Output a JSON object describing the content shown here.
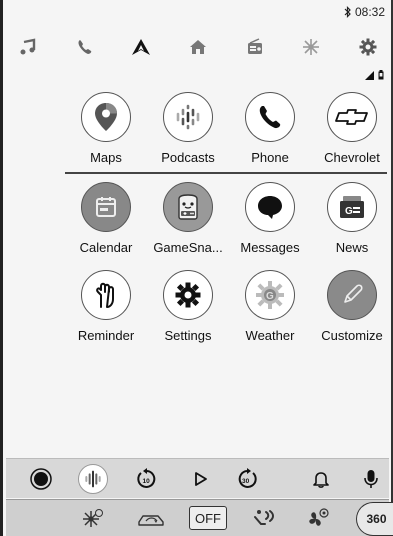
{
  "status": {
    "time": "08:32"
  },
  "topnav": [
    "music-icon",
    "phone-icon",
    "android-auto-icon",
    "home-icon",
    "radio-icon",
    "fan-icon",
    "gear-icon"
  ],
  "apps": {
    "row1": [
      {
        "label": "Maps",
        "icon": "maps-pin-icon"
      },
      {
        "label": "Podcasts",
        "icon": "podcasts-icon"
      },
      {
        "label": "Phone",
        "icon": "phone-icon"
      },
      {
        "label": "Chevrolet",
        "icon": "chevrolet-bowtie-icon"
      }
    ],
    "row2": [
      {
        "label": "Calendar",
        "icon": "calendar-icon"
      },
      {
        "label": "GameSna...",
        "icon": "gamesnacks-icon"
      },
      {
        "label": "Messages",
        "icon": "messages-icon"
      },
      {
        "label": "News",
        "icon": "news-icon"
      }
    ],
    "row3": [
      {
        "label": "Reminder",
        "icon": "reminder-hand-icon"
      },
      {
        "label": "Settings",
        "icon": "settings-icon"
      },
      {
        "label": "Weather",
        "icon": "weather-icon"
      },
      {
        "label": "Customize",
        "icon": "pencil-icon"
      }
    ]
  },
  "media": {
    "rewind_seconds": "10",
    "forward_seconds": "30"
  },
  "climate": {
    "off_label": "OFF",
    "auto360_label": "360"
  }
}
